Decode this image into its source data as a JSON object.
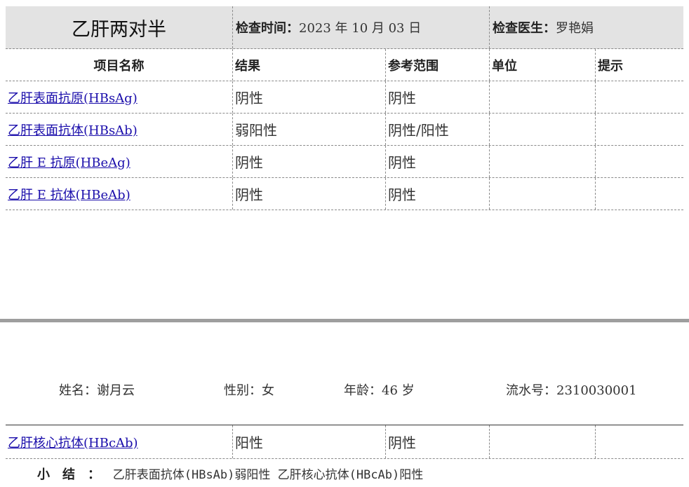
{
  "header": {
    "title": "乙肝两对半",
    "exam_time_label": "检查时间：",
    "exam_time_value": "2023 年 10 月 03 日",
    "doctor_label": "检查医生：",
    "doctor_value": "罗艳娟"
  },
  "columns": [
    "项目名称",
    "结果",
    "参考范围",
    "单位",
    "提示"
  ],
  "rows": [
    {
      "name": "乙肝表面抗原(HBsAg)",
      "result": "阴性",
      "reference": "阴性",
      "unit": "",
      "hint": ""
    },
    {
      "name": "乙肝表面抗体(HBsAb)",
      "result": "弱阳性",
      "reference": "阴性/阳性",
      "unit": "",
      "hint": ""
    },
    {
      "name": "乙肝 E 抗原(HBeAg)",
      "result": "阴性",
      "reference": "阴性",
      "unit": "",
      "hint": ""
    },
    {
      "name": "乙肝 E 抗体(HBeAb)",
      "result": "阴性",
      "reference": "阴性",
      "unit": "",
      "hint": ""
    }
  ],
  "patient": {
    "name": "姓名：谢月云",
    "gender": "性别：女",
    "age": "年龄：46 岁",
    "serial": "流水号：2310030001"
  },
  "rows2": [
    {
      "name": "乙肝核心抗体(HBcAb)",
      "result": "阳性",
      "reference": "阴性",
      "unit": "",
      "hint": ""
    }
  ],
  "summary": {
    "label": "小结：",
    "text": "乙肝表面抗体(HBsAb)弱阳性  乙肝核心抗体(HBcAb)阳性"
  }
}
